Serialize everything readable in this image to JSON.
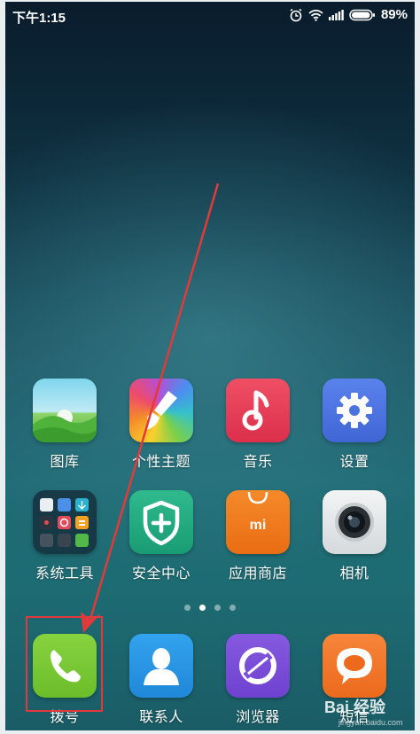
{
  "status_bar": {
    "time": "下午1:15",
    "battery_percent": "89%",
    "icons": [
      "alarm-icon",
      "wifi-icon",
      "signal-icon",
      "battery-icon"
    ]
  },
  "home": {
    "row1": [
      {
        "label": "图库",
        "icon": "gallery-icon"
      },
      {
        "label": "个性主题",
        "icon": "themes-icon"
      },
      {
        "label": "音乐",
        "icon": "music-icon"
      },
      {
        "label": "设置",
        "icon": "settings-icon"
      }
    ],
    "row2": [
      {
        "label": "系统工具",
        "icon": "folder-icon"
      },
      {
        "label": "安全中心",
        "icon": "security-icon"
      },
      {
        "label": "应用商店",
        "icon": "store-icon",
        "icon_text": "mi"
      },
      {
        "label": "相机",
        "icon": "camera-icon"
      }
    ],
    "page_indicator": {
      "total": 4,
      "active": 2
    }
  },
  "dock": [
    {
      "label": "拨号",
      "icon": "phone-icon"
    },
    {
      "label": "联系人",
      "icon": "contacts-icon"
    },
    {
      "label": "浏览器",
      "icon": "browser-icon"
    },
    {
      "label": "短信",
      "icon": "messages-icon"
    }
  ],
  "watermark": {
    "text": "Bai 经验",
    "sub": "jingyan.baidu.com"
  },
  "colors": {
    "annotation": "#e23a3a",
    "gallery": "#5bbf4a",
    "music": "#e8425a",
    "settings": "#4c73e0",
    "security": "#20a87e",
    "store": "#f07a1c",
    "phone": "#7ac936",
    "contacts": "#2a98e6",
    "browser": "#7b4fd8",
    "messages": "#f2762a"
  }
}
